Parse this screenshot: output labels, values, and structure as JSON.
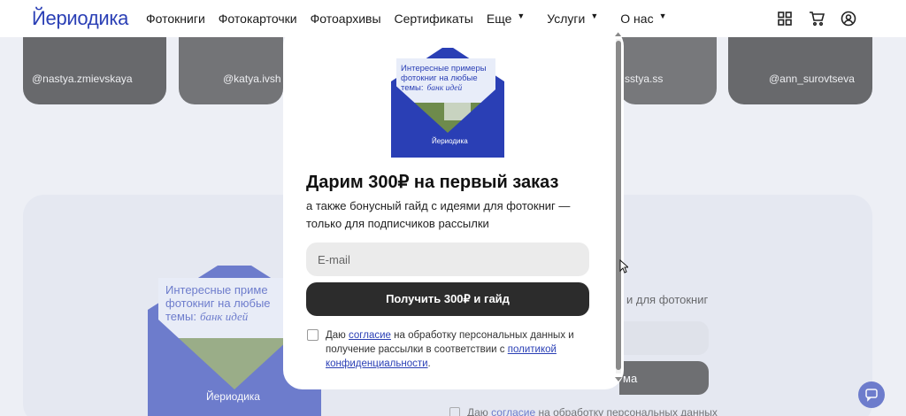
{
  "header": {
    "logo": "Йериодика",
    "nav": [
      {
        "label": "Фотокниги",
        "dropdown": false
      },
      {
        "label": "Фотокарточки",
        "dropdown": false
      },
      {
        "label": "Фотоархивы",
        "dropdown": false
      },
      {
        "label": "Сертификаты",
        "dropdown": false
      },
      {
        "label": "Еще",
        "dropdown": true
      },
      {
        "label": "Услуги",
        "dropdown": true
      },
      {
        "label": "О нас",
        "dropdown": true
      }
    ],
    "icons": [
      "grid-icon",
      "cart-icon",
      "user-icon"
    ]
  },
  "background": {
    "cards": [
      "@nastya.zmievskaya",
      "@katya.ivsh",
      "sstya.ss",
      "@ann_surovtseva"
    ],
    "envelope_text": "Интересные приме фотокниг на любые темы:",
    "envelope_handwriting": "банк идей",
    "envelope_brand": "Йериодика",
    "subtitle_fragment": "и для фотокниг",
    "button_fragment": "ма",
    "agree_prefix": "Даю",
    "agree_link": "согласие",
    "agree_rest": "на обработку персональных данных"
  },
  "modal": {
    "envelope": {
      "text": "Интересные примеры фотокниг на любые темы:",
      "handwriting": "банк идей",
      "brand": "Йериодика"
    },
    "title": "Дарим 300₽ на первый заказ",
    "subtitle": "а также бонусный гайд с идеями для фотокниг — только для подписчиков рассылки",
    "email_placeholder": "E-mail",
    "submit_label": "Получить 300₽ и гайд",
    "agree_prefix": "Даю",
    "agree_link1": "согласие",
    "agree_middle": "на обработку персональных данных и получение рассылки в соответствии с",
    "agree_link2": "политикой конфиденциальности",
    "agree_end": "."
  },
  "colors": {
    "brand": "#2a3fb5",
    "button": "#2c2c2c",
    "input": "#ebebeb"
  }
}
